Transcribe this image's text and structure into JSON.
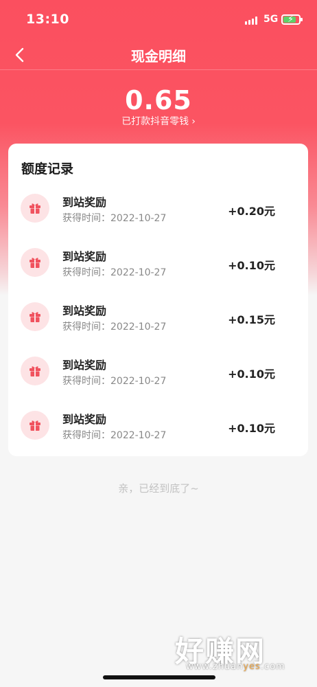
{
  "status": {
    "time": "13:10",
    "network": "5G",
    "battery_level": 0.8,
    "battery_color": "#5fd06a"
  },
  "header": {
    "title": "现金明细"
  },
  "balance": {
    "amount": "0.65",
    "subtitle": "已打款抖音零钱"
  },
  "records": {
    "title": "额度记录",
    "items": [
      {
        "title": "到站奖励",
        "time": "获得时间：2022-10-27",
        "amount": "+0.20元"
      },
      {
        "title": "到站奖励",
        "time": "获得时间：2022-10-27",
        "amount": "+0.10元"
      },
      {
        "title": "到站奖励",
        "time": "获得时间：2022-10-27",
        "amount": "+0.15元"
      },
      {
        "title": "到站奖励",
        "time": "获得时间：2022-10-27",
        "amount": "+0.10元"
      },
      {
        "title": "到站奖励",
        "time": "获得时间：2022-10-27",
        "amount": "+0.10元"
      }
    ]
  },
  "footer": {
    "end_note": "亲，已经到底了~"
  },
  "watermark": {
    "brand": "好赚网",
    "url_prefix": "www.zhuan",
    "url_highlight": "yes",
    "url_suffix": ".com"
  },
  "colors": {
    "accent": "#fb4f5f",
    "icon_bg": "#fde3e5",
    "icon_fg": "#f0525e"
  },
  "icons": {
    "back": "chevron-left-icon",
    "gift": "gift-icon",
    "more": "chevron-right-icon"
  }
}
